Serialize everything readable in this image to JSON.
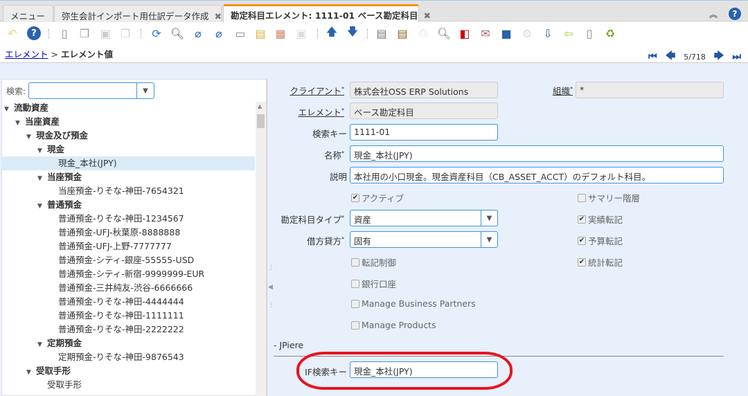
{
  "tabs": [
    {
      "label": "メニュー",
      "closable": false
    },
    {
      "label": "弥生会計インポート用仕訳データ作成",
      "closable": true
    },
    {
      "label": "勘定科目エレメント: 1111-01 ベース勘定科目",
      "closable": true,
      "active": true
    }
  ],
  "close_glyph": "✖",
  "breadcrumb": {
    "link": "エレメント",
    "sep": ">",
    "current": "エレメント値"
  },
  "navigation": {
    "record": "5/718"
  },
  "search": {
    "label": "検索:",
    "value": ""
  },
  "tree": [
    {
      "label": "流動資産",
      "level": 0,
      "folder": true
    },
    {
      "label": "当座資産",
      "level": 1,
      "folder": true
    },
    {
      "label": "現金及び預金",
      "level": 2,
      "folder": true
    },
    {
      "label": "現金",
      "level": 3,
      "folder": true
    },
    {
      "label": "現金_本社(JPY)",
      "level": 4,
      "selected": true
    },
    {
      "label": "当座預金",
      "level": 3,
      "folder": true
    },
    {
      "label": "当座預金-りそな-神田-7654321",
      "level": 4
    },
    {
      "label": "普通預金",
      "level": 3,
      "folder": true
    },
    {
      "label": "普通預金-りそな-神田-1234567",
      "level": 4
    },
    {
      "label": "普通預金-UFJ-秋葉原-8888888",
      "level": 4
    },
    {
      "label": "普通預金-UFJ-上野-7777777",
      "level": 4
    },
    {
      "label": "普通預金-シティ-銀座-55555-USD",
      "level": 4
    },
    {
      "label": "普通預金-シティ-新宿-9999999-EUR",
      "level": 4
    },
    {
      "label": "普通預金-三井純友-渋谷-6666666",
      "level": 4
    },
    {
      "label": "普通預金-りそな-神田-4444444",
      "level": 4
    },
    {
      "label": "普通預金-りそな-神田-1111111",
      "level": 4
    },
    {
      "label": "普通預金-りそな-神田-2222222",
      "level": 4
    },
    {
      "label": "定期預金",
      "level": 3,
      "folder": true
    },
    {
      "label": "定期預金-りそな-神田-9876543",
      "level": 4
    },
    {
      "label": "受取手形",
      "level": 2,
      "folder": true
    },
    {
      "label": "受取手形",
      "level": 3
    }
  ],
  "form": {
    "client": {
      "label": "クライアント",
      "value": "株式会社OSS ERP Solutions"
    },
    "org": {
      "label": "組織",
      "value": "*"
    },
    "element": {
      "label": "エレメント",
      "value": "ベース勘定科目"
    },
    "search_key": {
      "label": "検索キー",
      "value": "1111-01"
    },
    "name": {
      "label": "名称",
      "value": "現金_本社(JPY)"
    },
    "description": {
      "label": "説明",
      "value": "本社用の小口現金。現金資産科目（CB_ASSET_ACCT）のデフォルト科目。"
    },
    "account_type": {
      "label": "勘定科目タイプ",
      "value": "資産"
    },
    "account_sign": {
      "label": "借方貸方",
      "value": "固有"
    },
    "checkboxes": {
      "active": {
        "label": "アクティブ",
        "checked": true
      },
      "summary": {
        "label": "サマリー階層",
        "checked": false
      },
      "post_actual": {
        "label": "実績転記",
        "checked": true
      },
      "post_budget": {
        "label": "予算転記",
        "checked": true
      },
      "post_statistical": {
        "label": "統計転記",
        "checked": true
      },
      "doc_controlled": {
        "label": "転記制御",
        "checked": false
      },
      "bank_account": {
        "label": "銀行口座",
        "checked": false
      },
      "manage_bp": {
        "label": "Manage Business Partners",
        "checked": false
      },
      "manage_products": {
        "label": "Manage Products",
        "checked": false
      }
    },
    "section": "- JPiere",
    "if_search_key": {
      "label": "IF検索キー",
      "value": "現金_本社(JPY)"
    }
  },
  "colors": {
    "accent": "#f39200",
    "highlight": "#e8141e",
    "panel": "#e8f0fc"
  }
}
